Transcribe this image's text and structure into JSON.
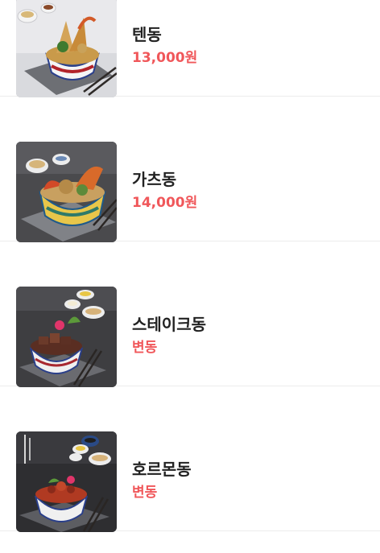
{
  "accent_price_color": "#f0575a",
  "menu": {
    "items": [
      {
        "name": "텐동",
        "price": "13,000원",
        "image": "tendon-bowl-photo"
      },
      {
        "name": "가츠동",
        "price": "14,000원",
        "image": "gatsudon-bowl-photo"
      },
      {
        "name": "스테이크동",
        "price": "변동",
        "image": "steak-don-bowl-photo"
      },
      {
        "name": "호르몬동",
        "price": "변동",
        "image": "hormone-don-bowl-photo"
      }
    ]
  }
}
